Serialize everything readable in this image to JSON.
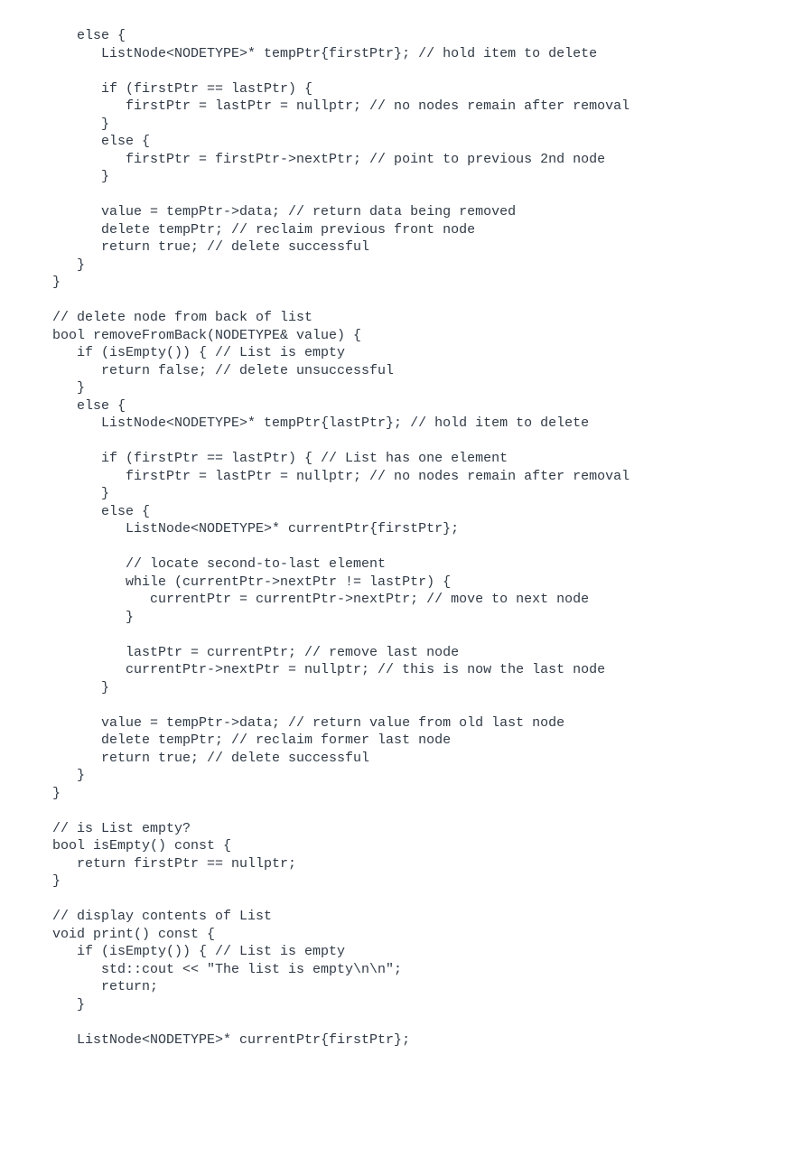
{
  "code": "   else {\n      ListNode<NODETYPE>* tempPtr{firstPtr}; // hold item to delete\n\n      if (firstPtr == lastPtr) {\n         firstPtr = lastPtr = nullptr; // no nodes remain after removal\n      }\n      else {\n         firstPtr = firstPtr->nextPtr; // point to previous 2nd node\n      }\n\n      value = tempPtr->data; // return data being removed\n      delete tempPtr; // reclaim previous front node\n      return true; // delete successful\n   }\n}\n\n// delete node from back of list\nbool removeFromBack(NODETYPE& value) {\n   if (isEmpty()) { // List is empty\n      return false; // delete unsuccessful\n   }\n   else {\n      ListNode<NODETYPE>* tempPtr{lastPtr}; // hold item to delete\n\n      if (firstPtr == lastPtr) { // List has one element\n         firstPtr = lastPtr = nullptr; // no nodes remain after removal\n      }\n      else {\n         ListNode<NODETYPE>* currentPtr{firstPtr};\n\n         // locate second-to-last element\n         while (currentPtr->nextPtr != lastPtr) {\n            currentPtr = currentPtr->nextPtr; // move to next node\n         }\n\n         lastPtr = currentPtr; // remove last node\n         currentPtr->nextPtr = nullptr; // this is now the last node\n      }\n\n      value = tempPtr->data; // return value from old last node\n      delete tempPtr; // reclaim former last node\n      return true; // delete successful\n   }\n}\n\n// is List empty?\nbool isEmpty() const {\n   return firstPtr == nullptr;\n}\n\n// display contents of List\nvoid print() const {\n   if (isEmpty()) { // List is empty\n      std::cout << \"The list is empty\\n\\n\";\n      return;\n   }\n\n   ListNode<NODETYPE>* currentPtr{firstPtr};"
}
